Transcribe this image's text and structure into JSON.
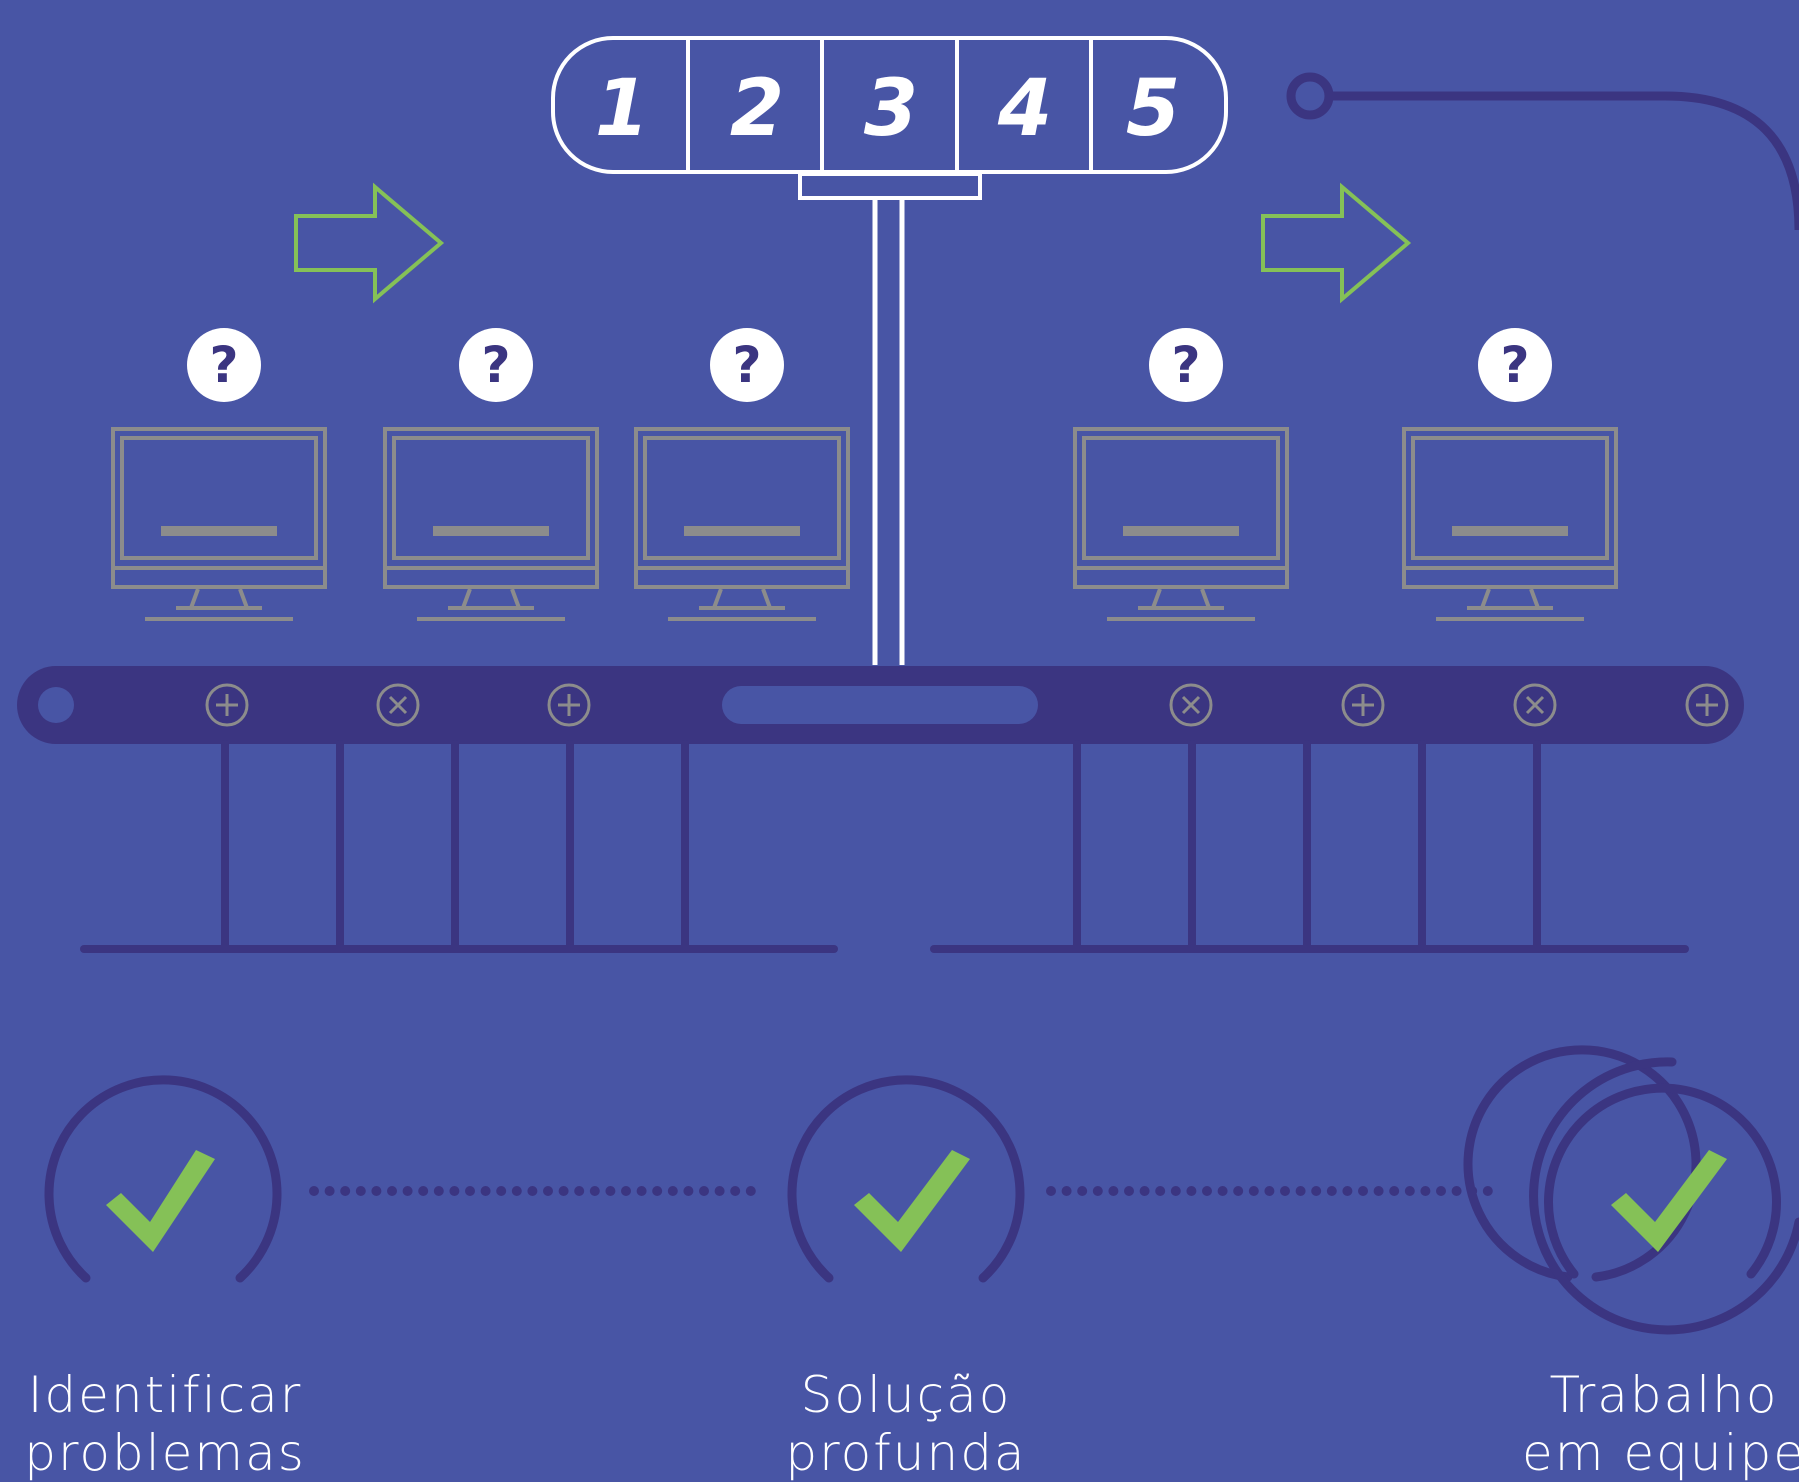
{
  "steps": [
    "1",
    "2",
    "3",
    "4",
    "5"
  ],
  "monitors": [
    {
      "badge": "?"
    },
    {
      "badge": "?"
    },
    {
      "badge": "?"
    },
    {
      "badge": "?"
    },
    {
      "badge": "?"
    }
  ],
  "rail_markers": [
    "plus",
    "cross",
    "plus",
    "cross",
    "plus",
    "cross",
    "plus"
  ],
  "stages": [
    {
      "line1": "Identificar",
      "line2": "problemas"
    },
    {
      "line1": "Solução",
      "line2": "profunda"
    },
    {
      "line1": "Trabalho",
      "line2": "em equipe"
    }
  ],
  "colors": {
    "background": "#4855a5",
    "dark": "#3b3581",
    "accent_green": "#85c157",
    "monitor_gray": "#8c8c8c",
    "white": "#ffffff"
  }
}
